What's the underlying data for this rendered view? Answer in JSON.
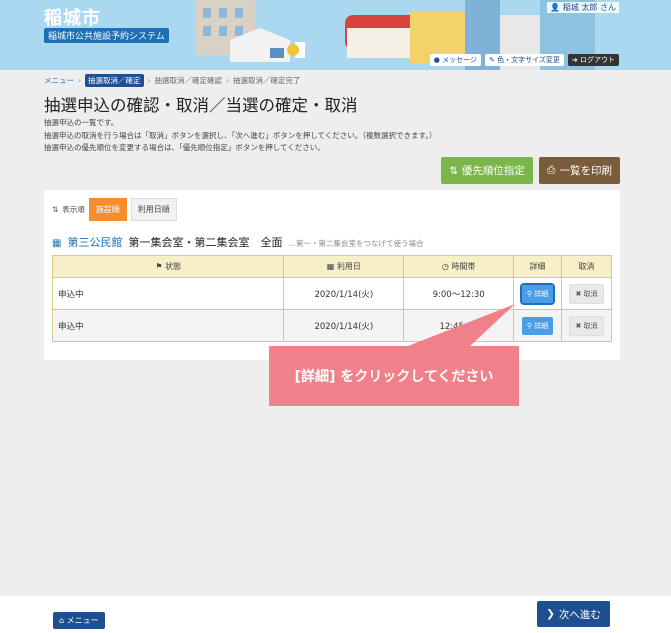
{
  "header": {
    "city_name": "稲城市",
    "system_name": "稲城市公共施設予約システム",
    "user_name": "稲城 太郎 さん",
    "buttons": {
      "message": "メッセージ",
      "color_text": "色・文字サイズ変更",
      "logout": "ログアウト"
    }
  },
  "breadcrumb": {
    "menu": "メニュー",
    "current": "抽選取消／確定",
    "step2": "抽選取消／確定確認",
    "step3": "抽選取消／確定完了"
  },
  "page_title": "抽選申込の確認・取消／当選の確定・取消",
  "description": [
    "抽選申込の一覧です。",
    "抽選申込の取消を行う場合は「取消」ボタンを選択し、「次へ進む」ボタンを押してください。（複数選択できます。）",
    "抽選申込の優先順位を変更する場合は、「優先順位指定」ボタンを押してください。"
  ],
  "actions": {
    "priority": "優先順位指定",
    "print": "一覧を印刷"
  },
  "sort": {
    "label": "表示順",
    "options": [
      "施設順",
      "利用日順"
    ],
    "active": "施設順"
  },
  "facility": {
    "name": "第三公民館",
    "room": "第一集会室・第二集会室　全面",
    "note": "…第一・第二集会室をつなげて使う場合"
  },
  "table": {
    "headers": {
      "status": "状態",
      "date": "利用日",
      "time": "時間帯",
      "detail": "詳細",
      "cancel": "取消"
    },
    "rows": [
      {
        "status": "申込中",
        "date": "2020/1/14(火)",
        "time": "9:00～12:30",
        "detail": "詳細",
        "cancel": "取消"
      },
      {
        "status": "申込中",
        "date": "2020/1/14(火)",
        "time": "12:45～1",
        "detail": "詳細",
        "cancel": "取消"
      }
    ]
  },
  "callout": "[詳細] をクリックしてください",
  "footer": {
    "menu": "メニュー",
    "next": "次へ進む"
  },
  "colors": {
    "brand": "#1d4f91",
    "accent_green": "#7ab648",
    "accent_brown": "#7a5c3a",
    "sort_active": "#f58c2e",
    "callout": "#f0818a"
  }
}
